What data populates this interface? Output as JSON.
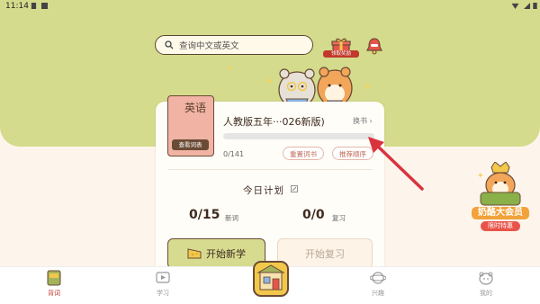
{
  "status": {
    "time": "11:14"
  },
  "search": {
    "placeholder": "查询中文或英文"
  },
  "gift": {
    "label": "领取奖励"
  },
  "book": {
    "cover_word": "英语",
    "view_button": "查看词表",
    "title": "人教版五年···026新版)",
    "change_label": "换书 ›",
    "progress": 0,
    "count": "0/141",
    "reset_label": "重置词书",
    "order_label": "推荐顺序"
  },
  "plan": {
    "title": "今日计划",
    "new_value": "0/15",
    "new_label": "新词",
    "review_value": "0/0",
    "review_label": "复习",
    "start_learn": "开始新学",
    "start_review": "开始复习"
  },
  "promo": {
    "title": "奶酪大会员",
    "subtitle": "限时特惠"
  },
  "nav": {
    "items": [
      {
        "label": "背词",
        "active": true
      },
      {
        "label": "学习",
        "active": false
      },
      {
        "label": "兴趣",
        "active": false
      },
      {
        "label": "我的",
        "active": false
      }
    ]
  },
  "colors": {
    "accent_green": "#d4db8c",
    "brown": "#6b4b35",
    "arrow_red": "#d9333f",
    "active_nav": "#c0392b"
  }
}
